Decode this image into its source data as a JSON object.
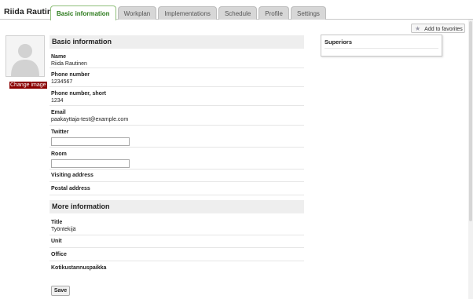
{
  "header": {
    "person_name": "Riida Rautinen"
  },
  "tabs": [
    {
      "label": "Basic information",
      "active": true
    },
    {
      "label": "Workplan",
      "active": false
    },
    {
      "label": "Implementations",
      "active": false
    },
    {
      "label": "Schedule",
      "active": false
    },
    {
      "label": "Profile",
      "active": false
    },
    {
      "label": "Settings",
      "active": false
    }
  ],
  "favorites": {
    "label": "Add to favorites",
    "icon": "star-icon"
  },
  "avatar": {
    "change_label": "Change image",
    "icon": "person-silhouette-icon"
  },
  "basic": {
    "title": "Basic information",
    "name_label": "Name",
    "name_value": "Riida Rautinen",
    "phone_label": "Phone number",
    "phone_value": "1234567",
    "phone_short_label": "Phone number, short",
    "phone_short_value": "1234",
    "email_label": "Email",
    "email_value": "paakayttaja-test@example.com",
    "twitter_label": "Twitter",
    "twitter_value": "",
    "room_label": "Room",
    "room_value": "",
    "visiting_label": "Visiting address",
    "postal_label": "Postal address"
  },
  "more": {
    "title": "More information",
    "title_label": "Title",
    "title_value": "Työntekijä",
    "unit_label": "Unit",
    "office_label": "Office",
    "cost_label": "Kotikustannuspaikka"
  },
  "save_label": "Save",
  "superiors": {
    "title": "Superiors"
  },
  "colors": {
    "active_tab_text": "#2a7a1a",
    "change_image_bg": "#8b0000"
  }
}
